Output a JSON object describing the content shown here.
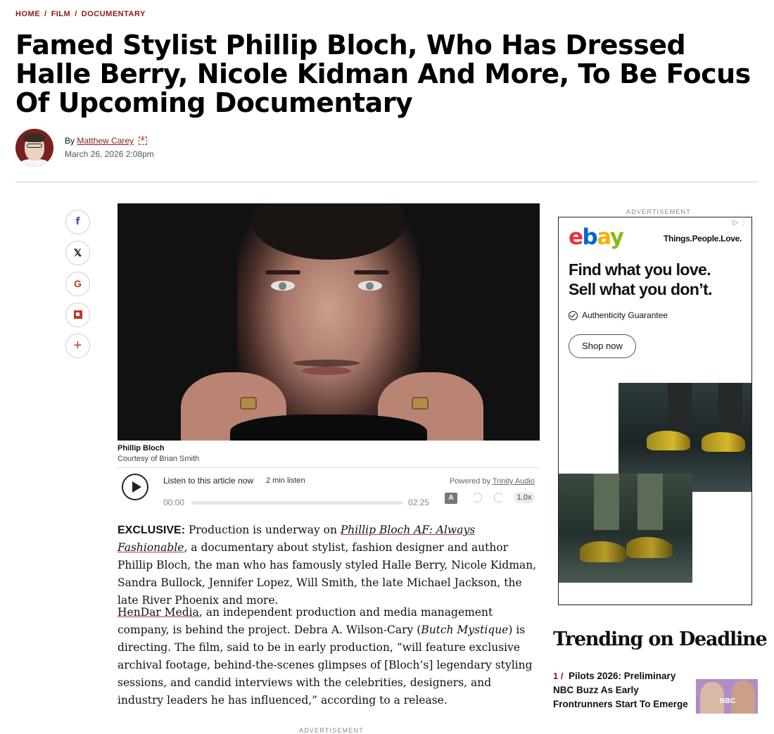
{
  "breadcrumb": [
    "HOME",
    "FILM",
    "DOCUMENTARY"
  ],
  "breadcrumb_sep": "/",
  "article": {
    "title": "Famed Stylist Phillip Bloch, Who Has Dressed Halle Berry, Nicole Kidman And More, To Be Focus Of Upcoming Documentary",
    "by_label": "By",
    "author": "Matthew Carey",
    "date": "March 26, 2026 2:08pm"
  },
  "share_icons": [
    "facebook-icon",
    "x-icon",
    "google-icon",
    "flipboard-icon",
    "plus-icon"
  ],
  "share_glyphs": {
    "facebook": "f",
    "x": "𝕏",
    "google": "G",
    "plus": "+"
  },
  "image": {
    "caption": "Phillip Bloch",
    "credit": "Courtesy of Brian Smith"
  },
  "audio": {
    "listen_label": "Listen to this article now",
    "duration_label": "2 min listen",
    "powered_by": "Powered by",
    "provider": "Trinity Audio",
    "current_time": "00:00",
    "total_time": "02:25",
    "progress": 0,
    "translate_glyph": "A",
    "speed": "1.0x"
  },
  "body": {
    "p1_lead": "EXCLUSIVE:",
    "p1_text_a": " Production is underway on ",
    "p1_link": "Phillip Bloch AF: Always Fashionable",
    "p1_text_b": ", a documentary about stylist, fashion designer and author Phillip Bloch, the man who has famously styled Halle Berry, Nicole Kidman, Sandra Bullock, Jennifer Lopez, Will Smith, the late Michael Jackson, the late River Phoenix and more.",
    "p2_link": "HenDar Media",
    "p2_text_a": ", an independent production and media management company, is behind the project. Debra A. Wilson-Cary (",
    "p2_italic": "Butch Mystique",
    "p2_text_b": ") is directing. The film, said to be in early production, “will feature exclusive archival footage, behind-the-scenes glimpses of [Bloch’s] legendary styling sessions, and candid interviews with the celebrities, designers, and industry leaders he has influenced,” according to a release."
  },
  "ads": {
    "label": "ADVERTISEMENT",
    "choices_glyph": "▷ ⋮",
    "logo_letters": [
      "e",
      "b",
      "a",
      "y"
    ],
    "tagline": "Things.People.Love.",
    "headline_1": "Find what you love.",
    "headline_2": "Sell what you don’t.",
    "authenticity": "Authenticity Guarantee",
    "cta": "Shop now"
  },
  "trending": {
    "title": "Trending on Deadline",
    "items": [
      {
        "rank": "1 /",
        "title": "Pilots 2026: Preliminary NBC Buzz As Early Frontrunners Start To Emerge",
        "thumb_badge": "NBC"
      }
    ]
  },
  "colors": {
    "accent": "#8b1a1a",
    "ebay_red": "#e53238",
    "ebay_blue": "#0064d2",
    "ebay_yellow": "#f5af02",
    "ebay_green": "#86b817"
  }
}
